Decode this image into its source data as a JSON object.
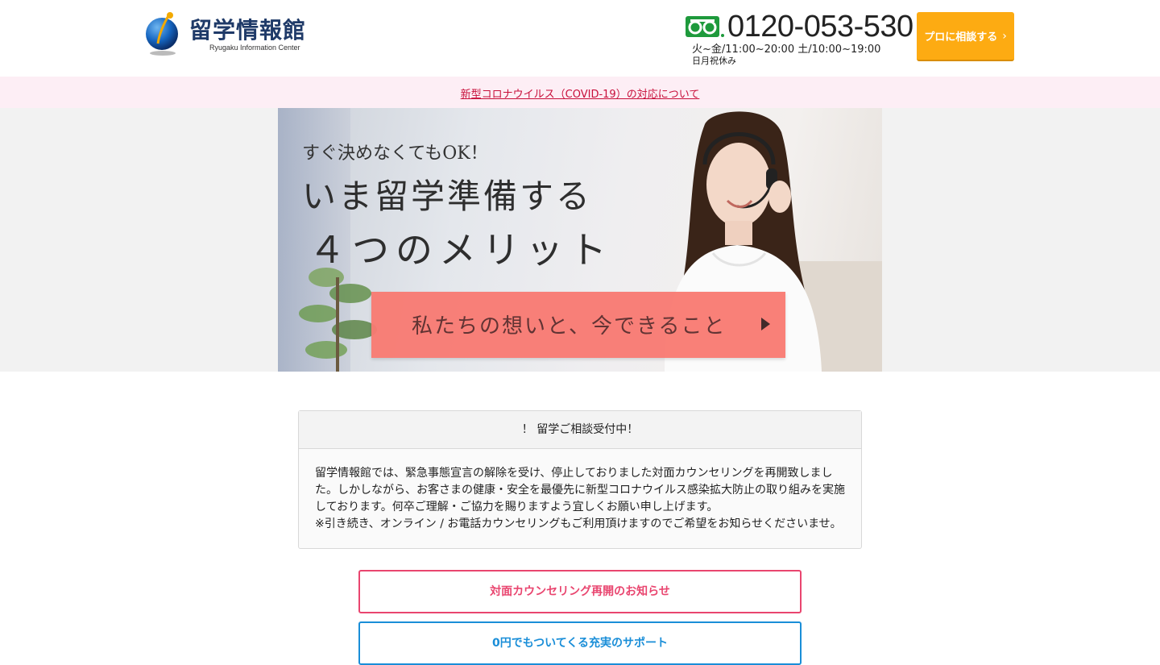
{
  "header": {
    "logo_name": "留学情報館",
    "logo_sub": "Ryugaku Information Center",
    "phone_number": "0120-053-530",
    "phone_hours": "火~金/11:00~20:00 土/10:00~19:00",
    "phone_closed": "日月祝休み",
    "cta_label": "プロに相談する",
    "cta_arrow": "›"
  },
  "notice": {
    "link_text": "新型コロナウイルス（COVID-19）の対応について"
  },
  "hero": {
    "line1": "すぐ決めなくてもOK！",
    "line2": "いま留学準備する",
    "line3": "４つのメリット",
    "banner_text": "私たちの想いと、今できること"
  },
  "consult": {
    "heading": "！ 留学ご相談受付中！",
    "body1": "留学情報館では、緊急事態宣言の解除を受け、停止しておりました対面カウンセリングを再開致しました。しかしながら、お客さまの健康・安全を最優先に新型コロナウイルス感染拡大防止の取り組みを実施しております。何卒ご理解・ご協力を賜りますよう宜しくお願い申し上げます。",
    "body2": "※引き続き、オンライン / お電話カウンセリングもご利用頂けますのでご希望をお知らせくださいませ。"
  },
  "buttons": {
    "reopen_label": "対面カウンセリング再開のお知らせ",
    "support_label": "0円でもついてくる充実のサポート"
  },
  "colors": {
    "cta_orange": "#fdab12",
    "notice_red": "#c80f3a",
    "pink_button": "#e9456f",
    "blue_button": "#1a8ed8",
    "logo_navy": "#1f3a68"
  }
}
